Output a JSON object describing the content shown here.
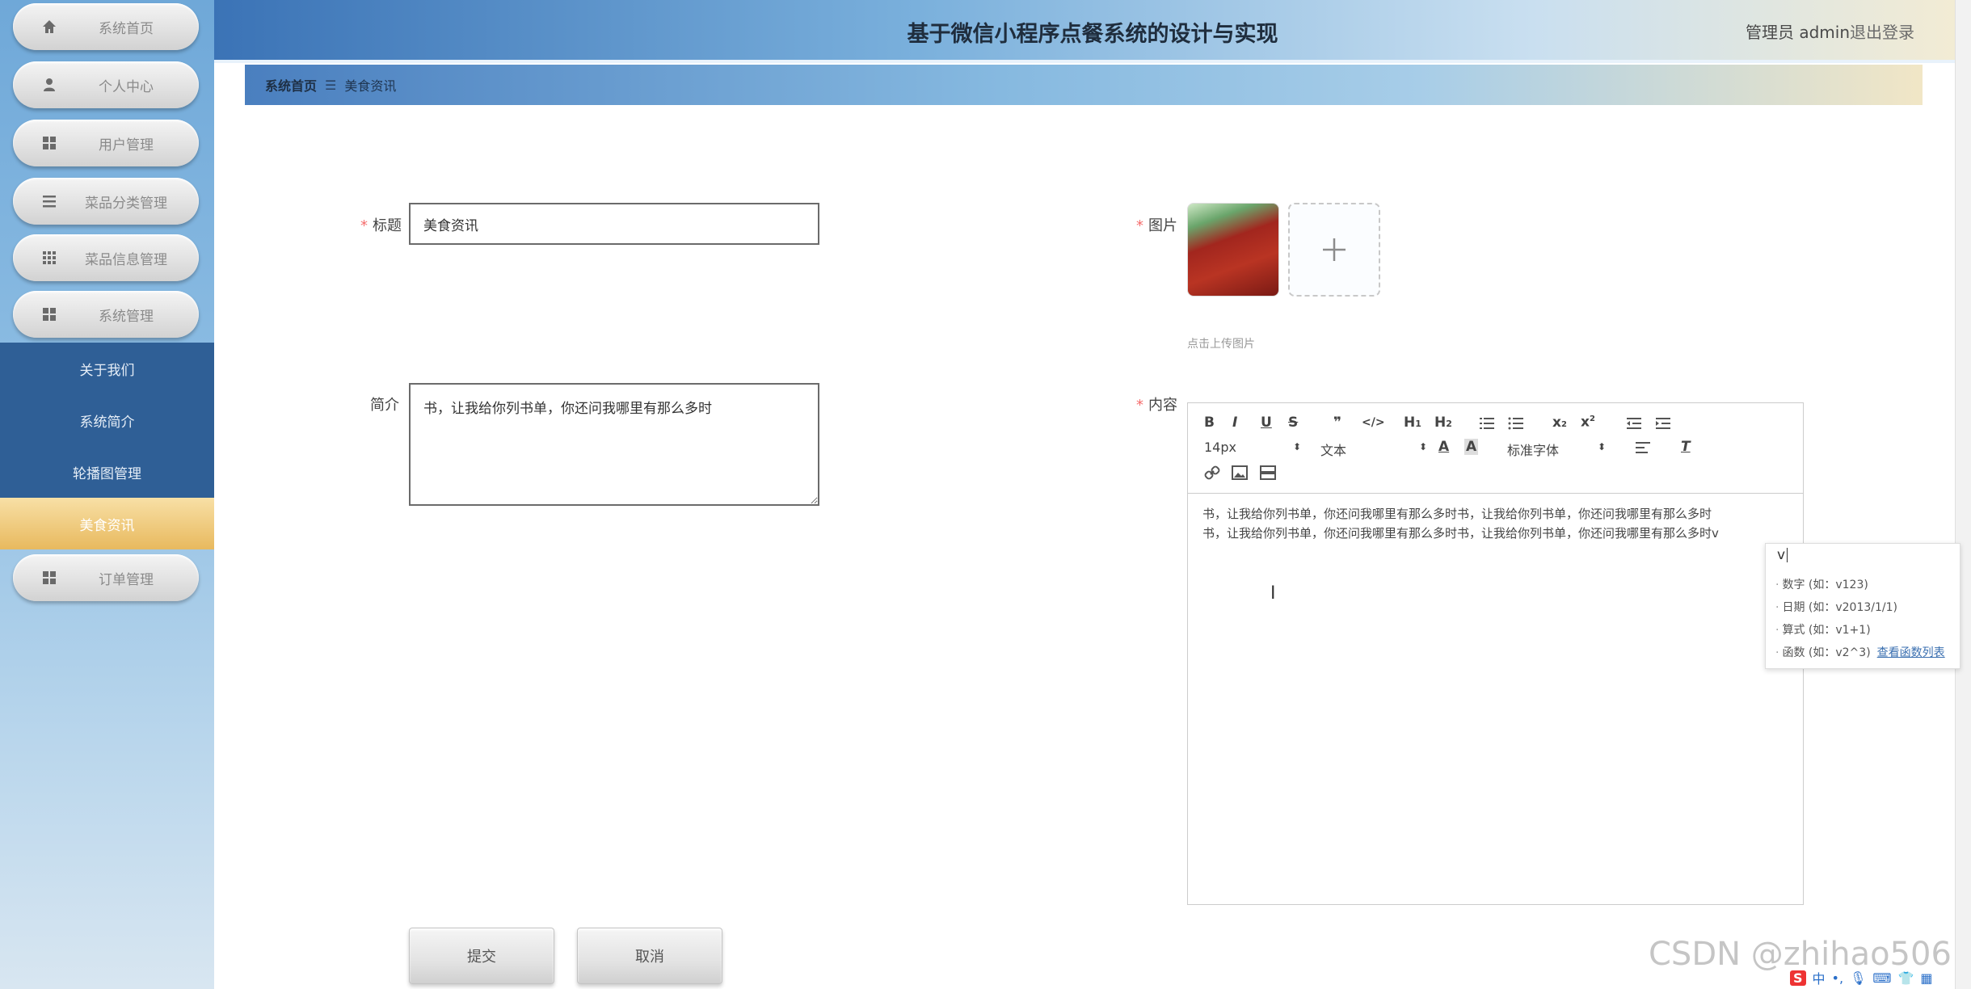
{
  "header": {
    "title": "基于微信小程序点餐系统的设计与实现",
    "user": "管理员 admin",
    "logout": "退出登录"
  },
  "sidebar": {
    "items": [
      {
        "label": "系统首页",
        "icon": "home-icon"
      },
      {
        "label": "个人中心",
        "icon": "user-icon"
      },
      {
        "label": "用户管理",
        "icon": "grid-icon"
      },
      {
        "label": "菜品分类管理",
        "icon": "list-icon"
      },
      {
        "label": "菜品信息管理",
        "icon": "apps-icon"
      },
      {
        "label": "系统管理",
        "icon": "grid-icon"
      }
    ],
    "submenu": [
      "关于我们",
      "系统简介",
      "轮播图管理",
      "美食资讯"
    ],
    "order": {
      "label": "订单管理",
      "icon": "grid-icon"
    }
  },
  "breadcrumb": {
    "home": "系统首页",
    "current": "美食资讯"
  },
  "form": {
    "title_label": "标题",
    "title_value": "美食资讯",
    "intro_label": "简介",
    "intro_value": "书，让我给你列书单，你还问我哪里有那么多时",
    "image_label": "图片",
    "upload_hint": "点击上传图片",
    "content_label": "内容",
    "submit": "提交",
    "cancel": "取消"
  },
  "editor": {
    "font_size": "14px",
    "paragraph": "文本",
    "font_family": "标准字体",
    "line1": "书，让我给你列书单，你还问我哪里有那么多时书，让我给你列书单，你还问我哪里有那么多时",
    "line2": "书，让我给你列书单，你还问我哪里有那么多时书，让我给你列书单，你还问我哪里有那么多时v"
  },
  "formula_popup": {
    "input": "v",
    "options": [
      "数字 (如：v123)",
      "日期 (如：v2013/1/1)",
      "算式 (如：v1+1)",
      "函数 (如：v2^3)"
    ],
    "link": "查看函数列表"
  },
  "watermark": "CSDN @zhihao506",
  "tray": "中"
}
